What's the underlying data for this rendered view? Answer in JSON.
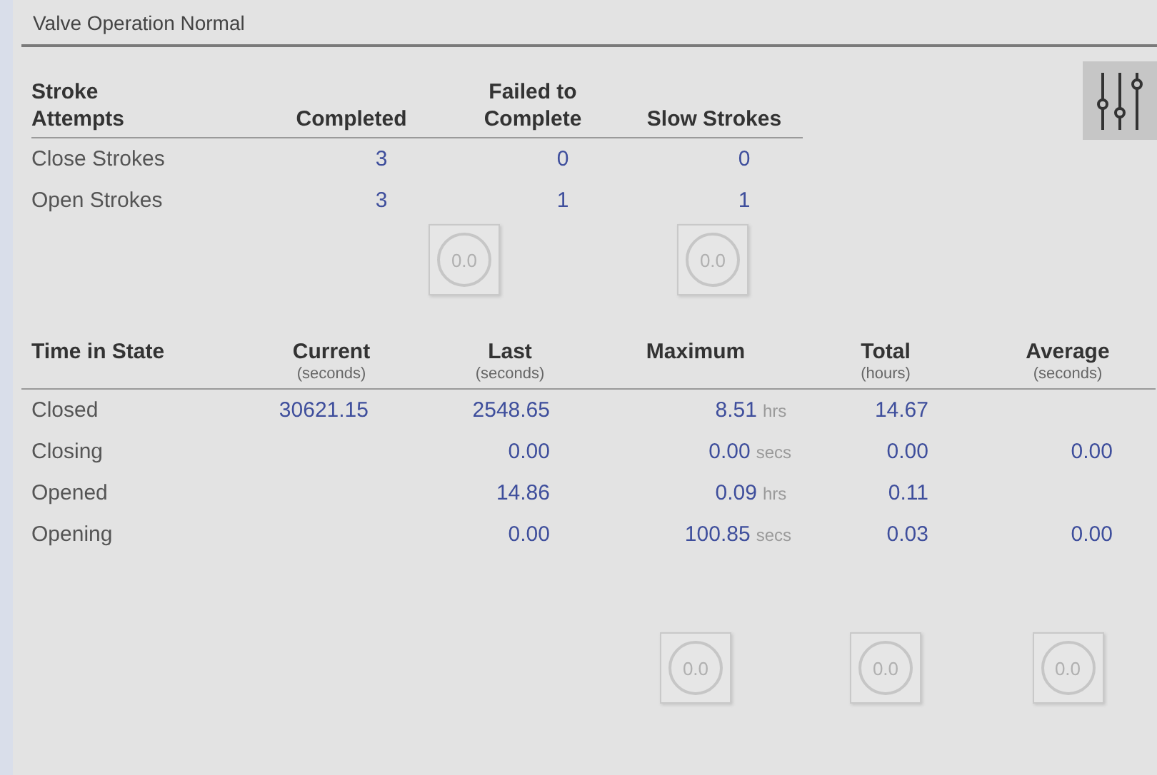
{
  "title": "Valve Operation Normal",
  "stroke_table": {
    "columns": [
      "Stroke Attempts",
      "Completed",
      "Failed to Complete",
      "Slow Strokes"
    ],
    "rows": [
      {
        "label": "Close Strokes",
        "completed": "3",
        "failed": "0",
        "slow": "0"
      },
      {
        "label": "Open Strokes",
        "completed": "3",
        "failed": "1",
        "slow": "1"
      }
    ]
  },
  "stroke_reset_buttons": [
    {
      "label": "0.0",
      "disabled": true
    },
    {
      "label": "0.0",
      "disabled": true
    }
  ],
  "time_table": {
    "columns": [
      {
        "label": "Time in State"
      },
      {
        "label": "Current",
        "unit": "(seconds)"
      },
      {
        "label": "Last",
        "unit": "(seconds)"
      },
      {
        "label": "Maximum"
      },
      {
        "label": "Total",
        "unit": "(hours)"
      },
      {
        "label": "Average",
        "unit": "(seconds)"
      }
    ],
    "rows": [
      {
        "state": "Closed",
        "current": "30621.15",
        "last": "2548.65",
        "maximum": "8.51",
        "maximum_unit": "hrs",
        "total": "14.67"
      },
      {
        "state": "Closing",
        "last": "0.00",
        "maximum": "0.00",
        "maximum_unit": "secs",
        "total": "0.00",
        "average": "0.00"
      },
      {
        "state": "Opened",
        "last": "14.86",
        "maximum": "0.09",
        "maximum_unit": "hrs",
        "total": "0.11"
      },
      {
        "state": "Opening",
        "last": "0.00",
        "maximum": "100.85",
        "maximum_unit": "secs",
        "total": "0.03",
        "average": "0.00"
      }
    ]
  },
  "time_reset_buttons": [
    {
      "label": "0.0",
      "disabled": true
    },
    {
      "label": "0.0",
      "disabled": true
    },
    {
      "label": "0.0",
      "disabled": true
    }
  ]
}
